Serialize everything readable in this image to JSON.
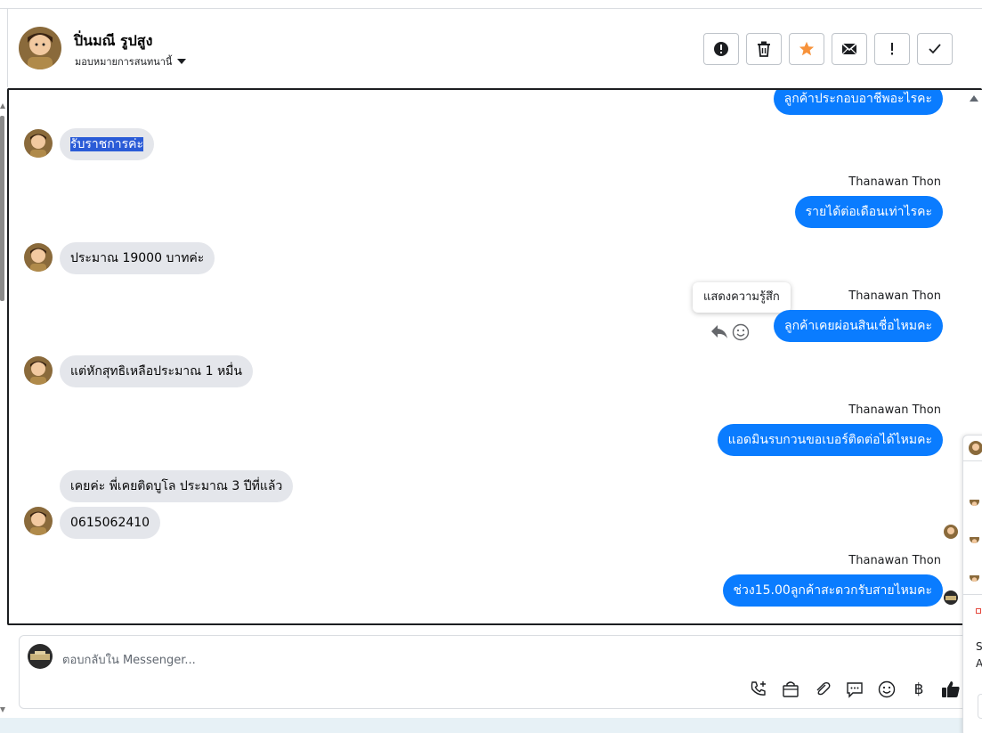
{
  "header": {
    "contact_name": "ปิ่นมณี รูปสูง",
    "assign_label": "มอบหมายการสนทนานี้",
    "actions": [
      {
        "name": "report-spam-button",
        "icon": "alert-circle-icon"
      },
      {
        "name": "delete-button",
        "icon": "trash-icon"
      },
      {
        "name": "star-button",
        "icon": "star-icon"
      },
      {
        "name": "mark-unread-button",
        "icon": "envelope-icon"
      },
      {
        "name": "follow-up-button",
        "icon": "exclamation-icon"
      },
      {
        "name": "mark-done-button",
        "icon": "check-icon"
      }
    ]
  },
  "colors": {
    "outgoing_bubble": "#0a7cff",
    "incoming_bubble": "#e4e6eb",
    "star": "#f7923a",
    "selection": "#2a5bd7"
  },
  "messages": {
    "m0": {
      "direction": "outgoing",
      "text": "ลูกค้าประกอบอาชีพอะไรคะ"
    },
    "m1": {
      "direction": "incoming",
      "text": "รับราชการค่ะ",
      "selected": true
    },
    "m2": {
      "direction": "outgoing",
      "sender": "Thanawan Thon",
      "text": "รายได้ต่อเดือนเท่าไรคะ"
    },
    "m3": {
      "direction": "incoming",
      "text": "ประมาณ 19000 บาทค่ะ"
    },
    "m4": {
      "direction": "outgoing",
      "sender": "Thanawan Thon",
      "text": "ลูกค้าเคยผ่อนสินเชื่อไหมคะ"
    },
    "m5": {
      "direction": "incoming",
      "text": "แต่หักสุทธิเหลือประมาณ 1 หมื่น"
    },
    "m6": {
      "direction": "outgoing",
      "sender": "Thanawan Thon",
      "text": "แอดมินรบกวนขอเบอร์ติดต่อได้ไหมคะ"
    },
    "m7": {
      "direction": "incoming",
      "text": "เคยค่ะ  พี่เคยติดบูโล ประมาณ 3 ปีที่แล้ว"
    },
    "m8": {
      "direction": "incoming",
      "text": "0615062410"
    },
    "m9": {
      "direction": "outgoing",
      "sender": "Thanawan Thon",
      "text": "ช่วง15.00ลูกค้าสะดวกรับสายไหมคะ"
    }
  },
  "tooltip": {
    "text": "แสดงความรู้สึก"
  },
  "composer": {
    "placeholder": "ตอบกลับใน Messenger...",
    "tools": [
      "phone-plus-icon",
      "shopping-bag-icon",
      "paperclip-icon",
      "saved-reply-icon",
      "emoji-icon",
      "baht-icon",
      "thumbs-up-icon"
    ],
    "baht_symbol": "฿"
  },
  "right_panel": {
    "partial_text_1": "S",
    "partial_text_2": "A"
  }
}
